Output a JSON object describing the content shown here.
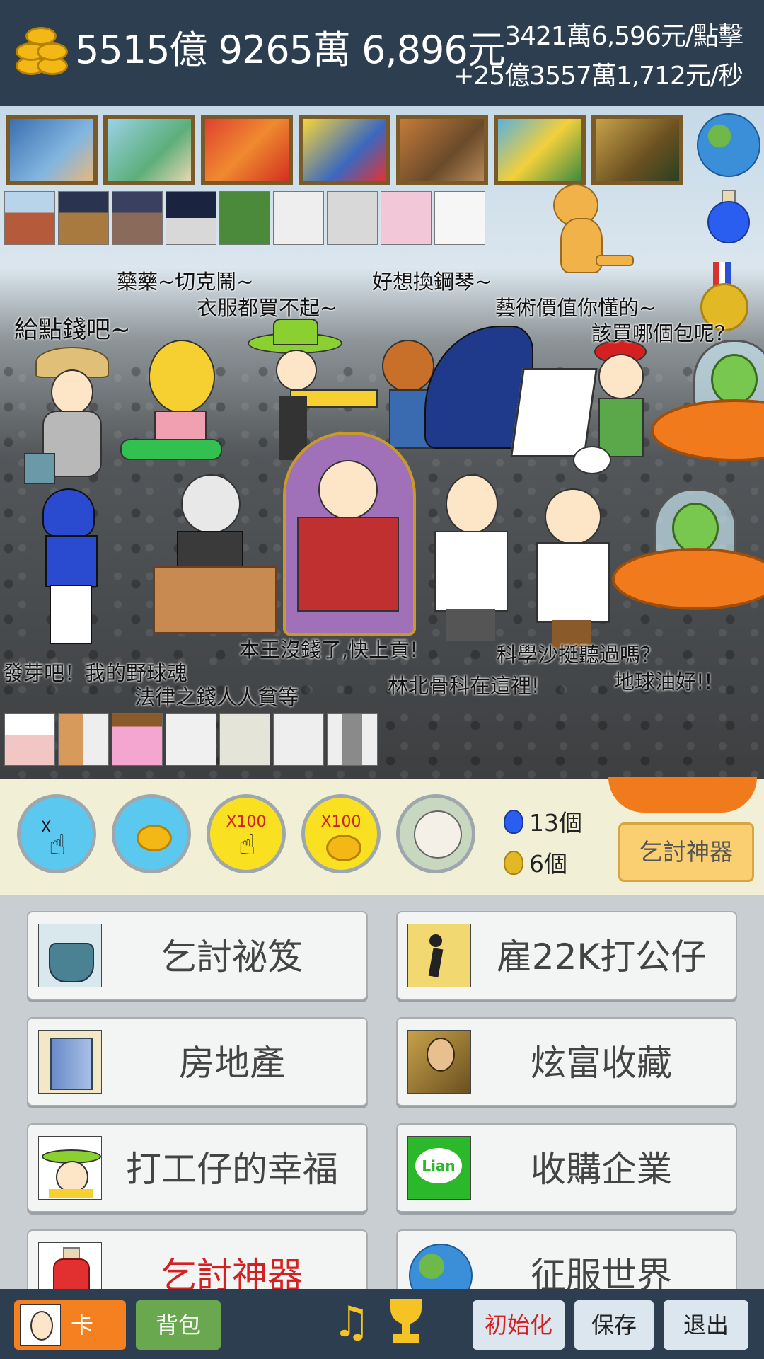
{
  "header": {
    "money": "5515億 9265萬 6,896元",
    "per_click": "3421萬6,596元/點擊",
    "per_sec": "+25億3557萬1,712元/秒"
  },
  "speech": [
    "藥藥~切克鬧~",
    "衣服都買不起~",
    "給點錢吧~",
    "好想換鋼琴~",
    "藝術價值你懂的~",
    "該買哪個包呢？",
    "本王沒錢了,快上貢!",
    "科學沙挺聽過嗎？",
    "發芽吧！我的野球魂",
    "法律之錢人人貧等",
    "林北骨科在這裡!",
    "地球油好!!"
  ],
  "controls": {
    "btn_x2_label": "X",
    "btn_x100_label": "X100",
    "potion_count": "13個",
    "gold_count": "6個",
    "god_button": "乞討神器"
  },
  "menu": [
    {
      "label": "乞討祕笈",
      "icon": "beggar-bowl-icon",
      "color": "#444444"
    },
    {
      "label": "雇22K打公仔",
      "icon": "worker-sign-icon",
      "color": "#444444"
    },
    {
      "label": "房地產",
      "icon": "building-icon",
      "color": "#444444"
    },
    {
      "label": "炫富收藏",
      "icon": "mona-lisa-icon",
      "color": "#444444"
    },
    {
      "label": "打工仔的幸福",
      "icon": "hat-man-icon",
      "color": "#444444"
    },
    {
      "label": "收購企業",
      "icon": "lian-logo-icon",
      "color": "#444444"
    },
    {
      "label": "乞討神器",
      "icon": "potion-icon",
      "color": "#d42020"
    },
    {
      "label": "征服世界",
      "icon": "globe-icon",
      "color": "#444444"
    }
  ],
  "bottom": {
    "card": "卡",
    "bag": "背包",
    "reset": "初始化",
    "save": "保存",
    "quit": "退出"
  },
  "colors": {
    "topbar": "#2c3e50",
    "orange": "#f4801f",
    "green": "#6aa84f",
    "gold_btn": "#f9cf72",
    "reset_text": "#d42020"
  }
}
